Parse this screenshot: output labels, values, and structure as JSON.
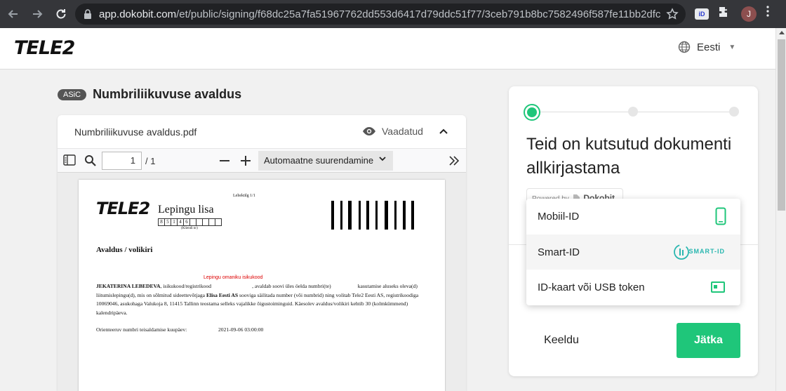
{
  "browser": {
    "url_host": "app.dokobit.com",
    "url_path": "/et/public/signing/f68dc25a7fa51967762dd553d6417d79ddc51f77/3ceb791b8bc7582496f587fe11bb2dfc1f...",
    "id_extension_label": "iD",
    "avatar_initial": "J"
  },
  "header": {
    "logo": "TELE2",
    "language": "Eesti"
  },
  "document": {
    "badge": "ASiC",
    "title": "Numbriliikuvuse avaldus",
    "file_name": "Numbriliikuvuse avaldus.pdf",
    "viewed_label": "Vaadatud"
  },
  "pdf_toolbar": {
    "page_current": "1",
    "page_total": "/ 1",
    "zoom_label": "Automaatne suurendamine"
  },
  "pdf_content": {
    "logo": "TELE2",
    "page_label": "Lehekülg 1/1",
    "title": "Lepingu lisa",
    "boxes": [
      "8",
      "5",
      "1",
      "4",
      "6",
      "",
      "",
      "",
      "",
      ""
    ],
    "boxes_label": "(Kliendi nr)",
    "section": "Avaldus / volikiri",
    "red_label": "Lepingu omaniku isikukood",
    "body_name": "JEKATERINA LEBEDEVA",
    "body_p1": ", isikukood/registrikood",
    "body_p2": ", avaldab soovi üles öelda numbri(te)",
    "body_p3": "kasutamise aluseks oleva(d) liitumislepingu(d), mis on sõlmitud sideettevõtjaga",
    "body_company": "Elisa Eesti AS",
    "body_p4": "sooviga säilitada number (või numbrid) ning volitab Tele2 Eesti AS, registrikoodiga 10069046, asukohaga Valukoja 8, 11415 Tallinn teostama selleks vajalikke õigustoiminguid. Käesolev avaldus/volikiri kehtib 30 (kolmkümmend) kalendripäeva.",
    "date_label": "Orienteeruv numbri teisaldamise kuupäev:",
    "date_value": "2021-09-06 03:00:00"
  },
  "sign_panel": {
    "heading": "Teid on kutsutud dokumenti allkirjastama",
    "powered_by": "Powered by",
    "powered_brand": "Dokobit",
    "methods": [
      {
        "label": "Mobiil-ID",
        "icon": "phone-icon"
      },
      {
        "label": "Smart-ID",
        "icon": "smart-id-logo",
        "logo_text": "SMART-ID"
      },
      {
        "label": "ID-kaart või USB token",
        "icon": "id-card-icon"
      }
    ],
    "decline_label": "Keeldu",
    "continue_label": "Jätka"
  },
  "colors": {
    "accent": "#1fc67a",
    "smart_id": "#2ab7b0"
  }
}
